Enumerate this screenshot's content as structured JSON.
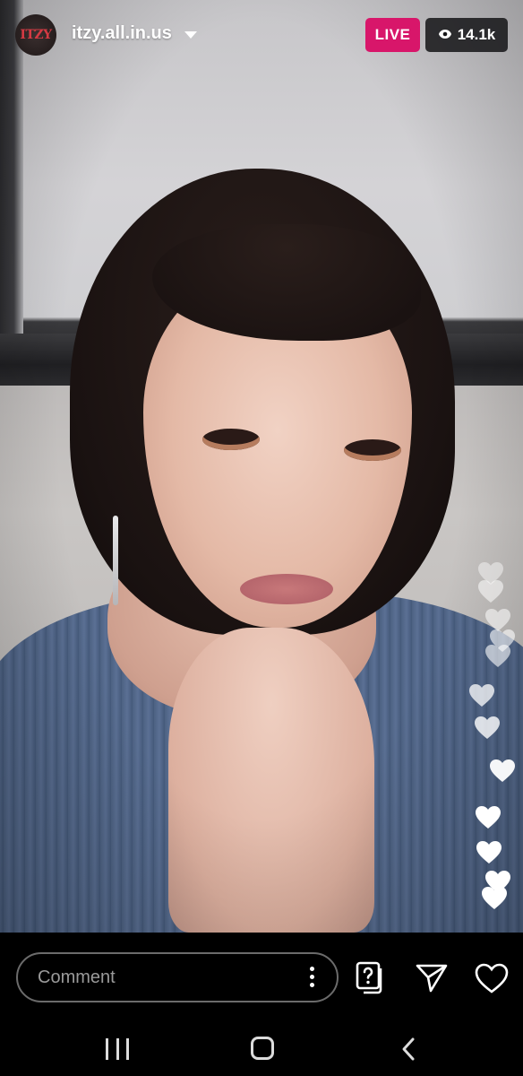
{
  "header": {
    "avatar_text": "ITZY",
    "username": "itzy.all.in.us",
    "live_label": "LIVE",
    "viewer_count": "14.1k"
  },
  "comment": {
    "placeholder": "Comment"
  },
  "colors": {
    "live_badge": "#d8166a",
    "viewer_badge": "#141416",
    "avatar_text": "#d43a43"
  },
  "icons": {
    "header": [
      "chevron-down-icon",
      "eye-icon"
    ],
    "bottom": [
      "more-vertical-icon",
      "question-card-icon",
      "send-icon",
      "heart-icon"
    ],
    "system_nav": [
      "recents-icon",
      "home-icon",
      "back-icon"
    ]
  }
}
